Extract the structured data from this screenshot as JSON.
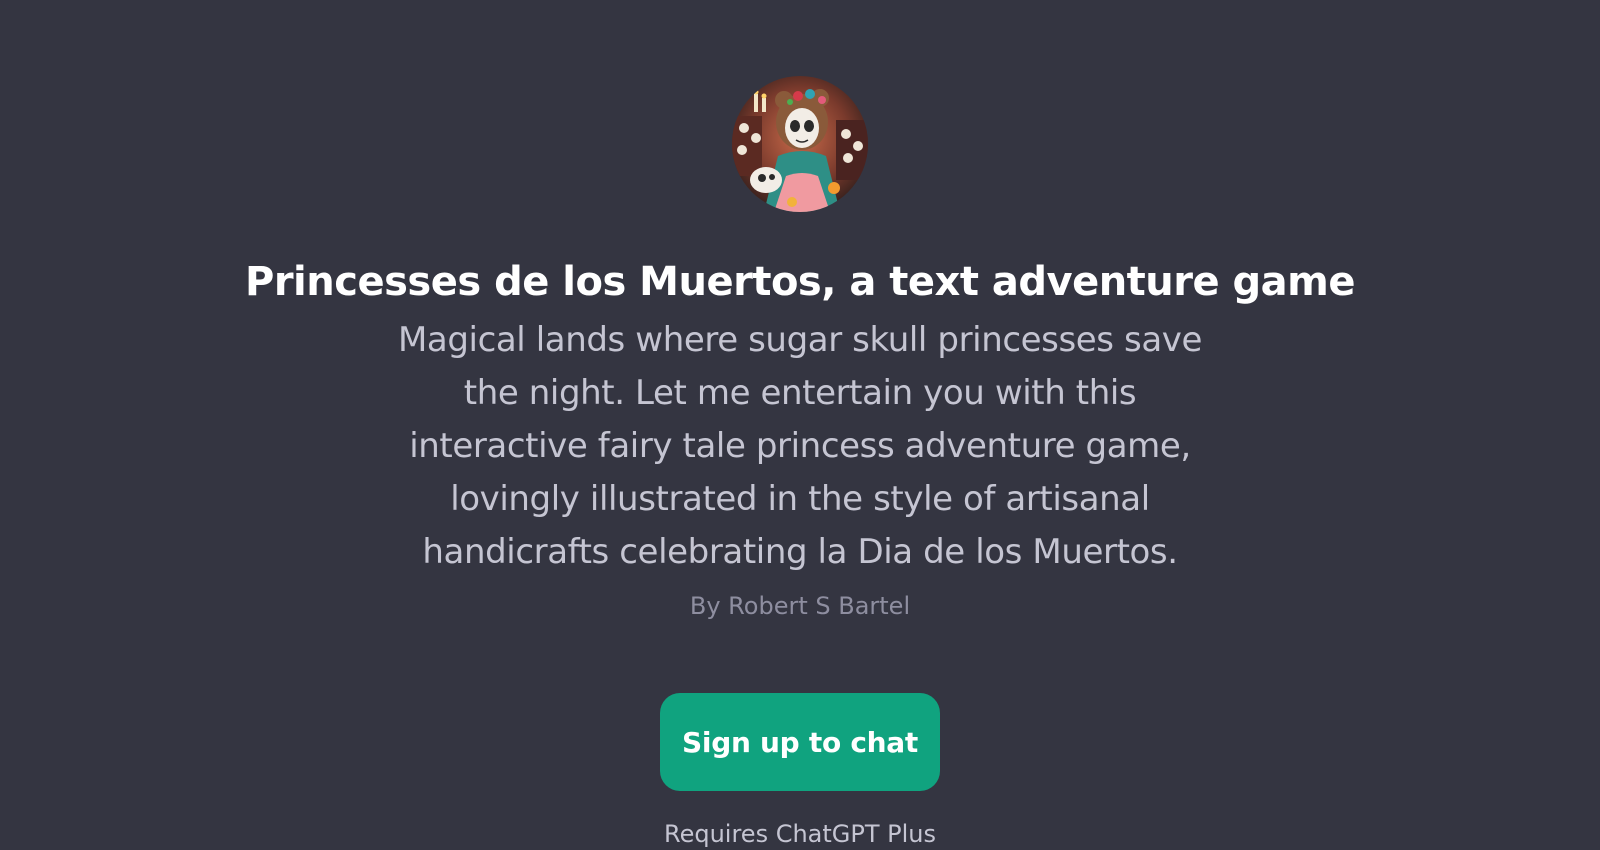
{
  "gpt": {
    "title": "Princesses de los Muertos, a text adventure game",
    "description_lines": [
      "Magical lands where sugar skull princesses save",
      "the night. Let me entertain you with this",
      "interactive fairy tale princess adventure game,",
      "lovingly illustrated in the style of artisanal",
      "handicrafts celebrating la Dia de los Muertos."
    ],
    "author": "By Robert S Bartel",
    "avatar_icon": "sugar-skull-princess-avatar"
  },
  "cta": {
    "label": "Sign up to chat"
  },
  "footer": {
    "text": "Requires ChatGPT Plus"
  },
  "colors": {
    "background": "#343541",
    "title": "#ffffff",
    "description": "#c5c5d2",
    "author": "#8e8ea0",
    "button": "#10a37f"
  }
}
